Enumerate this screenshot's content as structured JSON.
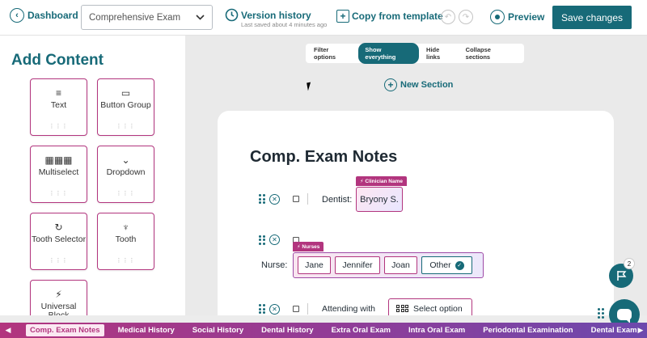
{
  "topbar": {
    "back_label": "Dashboard",
    "template_select": "Comprehensive Exam",
    "version_history": "Version history",
    "last_saved": "Last saved about 4 minutes ago",
    "copy_template": "Copy from template",
    "preview": "Preview",
    "save": "Save changes"
  },
  "left_panel": {
    "title": "Add Content",
    "tiles": [
      {
        "label": "Text",
        "icon": "text-lines-icon"
      },
      {
        "label": "Button Group",
        "icon": "button-group-icon"
      },
      {
        "label": "Multiselect",
        "icon": "grid-icon"
      },
      {
        "label": "Dropdown",
        "icon": "chevron-down-icon"
      },
      {
        "label": "Tooth Selector",
        "icon": "refresh-icon"
      },
      {
        "label": "Tooth",
        "icon": "tooth-icon"
      },
      {
        "label": "Universal Block",
        "icon": "bolt-icon"
      }
    ]
  },
  "filter": {
    "label": "Filter options",
    "options": [
      "Show everything",
      "Hide links",
      "Collapse sections"
    ],
    "active": "Show everything"
  },
  "new_section": "New Section",
  "card": {
    "title": "Comp. Exam Notes",
    "dentist": {
      "tag": "⚡ Clinician Name",
      "label": "Dentist:",
      "value": "Bryony S."
    },
    "nurse": {
      "tag": "⚡ Nurses",
      "label": "Nurse:",
      "options": [
        "Jane",
        "Jennifer",
        "Joan",
        "Other"
      ],
      "selected": "Other"
    },
    "attending": {
      "label": "Attending with",
      "placeholder": "Select option"
    }
  },
  "flag_badge": "2",
  "tabs": [
    "Comp. Exam Notes",
    "Medical History",
    "Social History",
    "Dental History",
    "Extra Oral Exam",
    "Intra Oral Exam",
    "Periodontal Examination",
    "Dental Exam"
  ],
  "active_tab": "Comp. Exam Notes",
  "colors": {
    "teal": "#176a78",
    "magenta": "#b2357e",
    "purple": "#6d49ad"
  }
}
